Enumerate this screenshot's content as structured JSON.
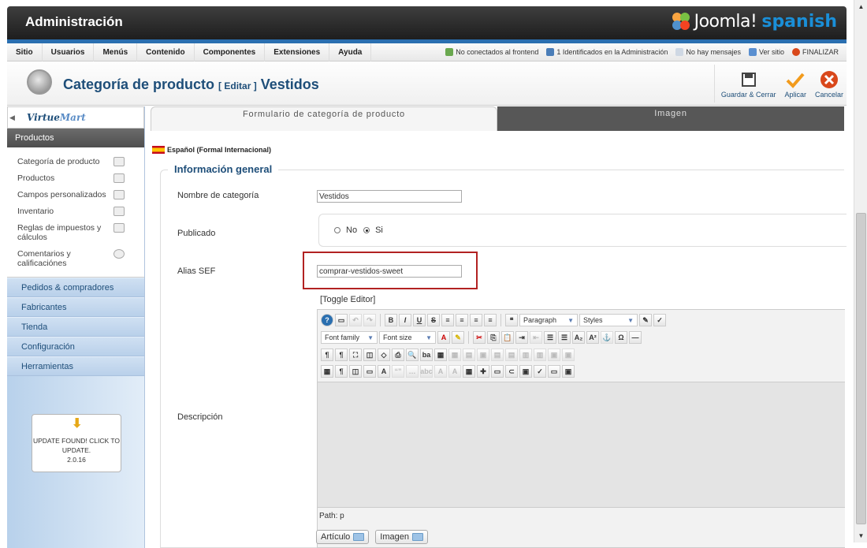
{
  "header": {
    "title": "Administración",
    "logo_main": "Joomla!",
    "logo_suffix": "spanish"
  },
  "menubar": {
    "items": [
      "Sitio",
      "Usuarios",
      "Menús",
      "Contenido",
      "Componentes",
      "Extensiones",
      "Ayuda"
    ],
    "status": {
      "frontend": "No conectados al frontend",
      "admin": "1 Identificados en la Administración",
      "messages": "No hay mensajes",
      "view_site": "Ver sitio",
      "logout": "FINALIZAR"
    }
  },
  "toolbar": {
    "title_main": "Categoría de producto",
    "title_edit": "[ Editar ]",
    "title_item": "Vestidos",
    "save_close": "Guardar & Cerrar",
    "apply": "Aplicar",
    "cancel": "Cancelar"
  },
  "sidebar": {
    "active_section": "Productos",
    "items": [
      {
        "label": "Categoría de producto"
      },
      {
        "label": "Productos"
      },
      {
        "label": "Campos personalizados"
      },
      {
        "label": "Inventario"
      },
      {
        "label": "Reglas de impuestos y cálculos"
      },
      {
        "label": "Comentarios y calificaciónes"
      }
    ],
    "sections": [
      "Pedidos & compradores",
      "Fabricantes",
      "Tienda",
      "Configuración",
      "Herramientas"
    ],
    "update_text": "UPDATE FOUND! CLICK TO UPDATE.",
    "update_version": "2.0.16"
  },
  "tabs": [
    "Formulario de categoría de producto",
    "Imagen"
  ],
  "language": "Español (Formal Internacional)",
  "form": {
    "legend": "Información general",
    "name_label": "Nombre de categoría",
    "name_value": "Vestidos",
    "published_label": "Publicado",
    "radio_no": "No",
    "radio_yes": "Si",
    "alias_label": "Alias SEF",
    "alias_value": "comprar-vestidos-sweet",
    "toggle_editor": "[Toggle Editor]",
    "description_label": "Descripción"
  },
  "editor": {
    "format_select": "Paragraph",
    "styles_select": "Styles",
    "font_family": "Font family",
    "font_size": "Font size",
    "path": "Path: p"
  },
  "bottom_buttons": [
    "Artículo",
    "Imagen"
  ]
}
